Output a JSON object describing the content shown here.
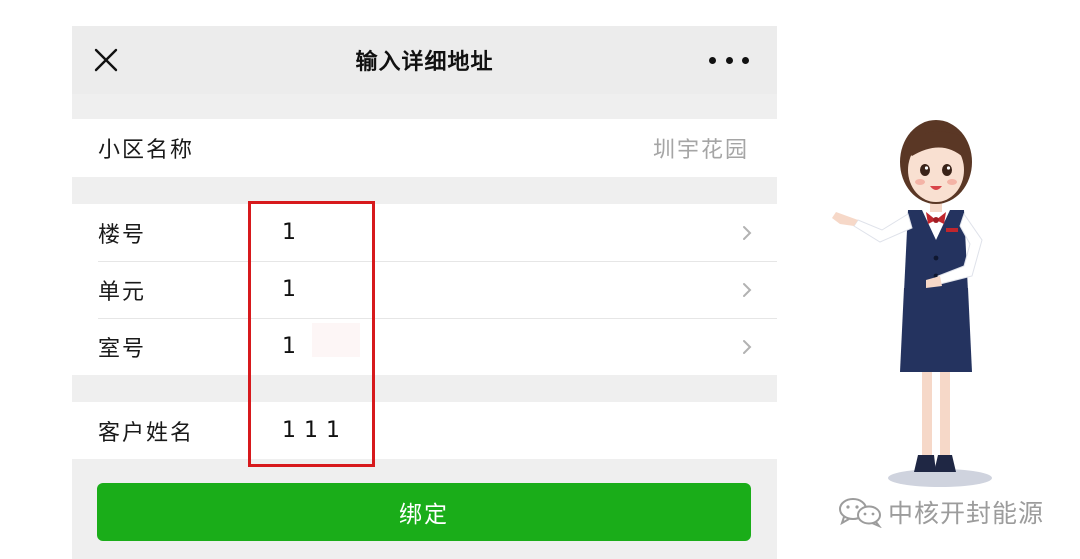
{
  "nav": {
    "title": "输入详细地址",
    "close_icon": "close-icon",
    "more_icon": "more-dots-icon"
  },
  "community": {
    "label": "小区名称",
    "value": "圳宇花园"
  },
  "address": [
    {
      "label": "楼号",
      "value": "1",
      "icon": "chevron-right-icon"
    },
    {
      "label": "单元",
      "value": "1",
      "icon": "chevron-right-icon"
    },
    {
      "label": "室号",
      "value": "1",
      "icon": "chevron-right-icon"
    }
  ],
  "customer": {
    "label": "客户姓名",
    "value": "111"
  },
  "bind_button": {
    "label": "绑定"
  },
  "watermark": {
    "icon": "wechat-icon",
    "text": "中核开封能源"
  },
  "colors": {
    "primary_green": "#1aad19",
    "highlight_red": "#d7191c"
  }
}
